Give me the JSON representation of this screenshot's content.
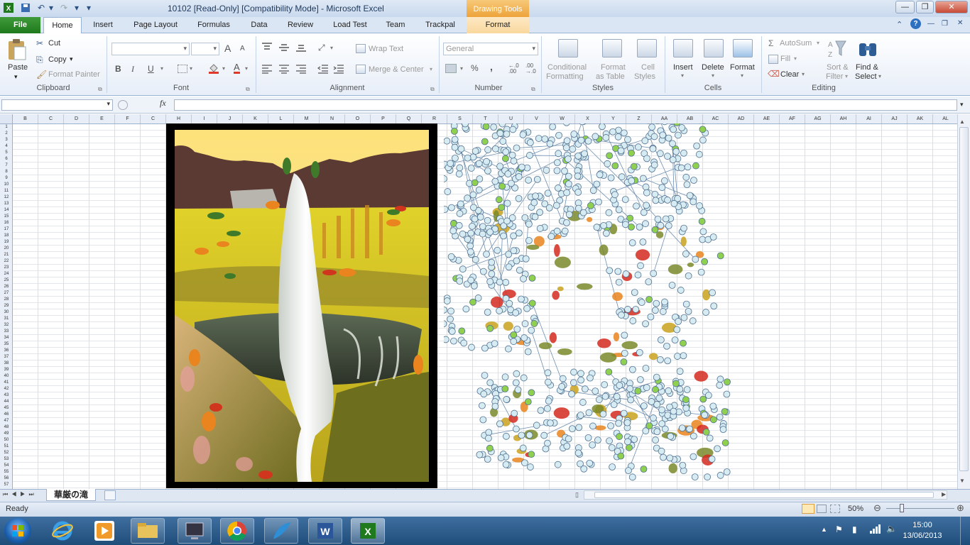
{
  "window": {
    "title": "10102  [Read-Only]  [Compatibility Mode]  -  Microsoft Excel",
    "contextual_group": "Drawing Tools",
    "buttons": {
      "minimize": "—",
      "restore": "❐",
      "close": "✕"
    }
  },
  "tabs": [
    {
      "label": "File"
    },
    {
      "label": "Home"
    },
    {
      "label": "Insert"
    },
    {
      "label": "Page Layout"
    },
    {
      "label": "Formulas"
    },
    {
      "label": "Data"
    },
    {
      "label": "Review"
    },
    {
      "label": "Load Test"
    },
    {
      "label": "Team"
    },
    {
      "label": "Trackpal"
    },
    {
      "label": "Format"
    }
  ],
  "ribbon": {
    "clipboard": {
      "paste": "Paste",
      "cut": "Cut",
      "copy": "Copy",
      "format_painter": "Format Painter",
      "label": "Clipboard"
    },
    "font": {
      "bold": "B",
      "italic": "I",
      "underline": "U",
      "grow": "A",
      "shrink": "A",
      "label": "Font"
    },
    "alignment": {
      "wrap_text": "Wrap Text",
      "merge_center": "Merge & Center",
      "label": "Alignment"
    },
    "number": {
      "format": "General",
      "percent": "%",
      "comma": ",",
      "label": "Number"
    },
    "styles": {
      "conditional": "Conditional",
      "conditional2": "Formatting",
      "format_table": "Format",
      "format_table2": "as Table",
      "cell_styles": "Cell",
      "cell_styles2": "Styles",
      "label": "Styles"
    },
    "cells": {
      "insert": "Insert",
      "delete": "Delete",
      "format": "Format",
      "label": "Cells"
    },
    "editing": {
      "autosum": "AutoSum",
      "fill": "Fill",
      "clear": "Clear",
      "sort": "Sort &",
      "sort2": "Filter",
      "find": "Find &",
      "find2": "Select",
      "label": "Editing"
    }
  },
  "formula_bar": {
    "fx": "fx",
    "name_box": "",
    "formula": ""
  },
  "columns": [
    "B",
    "C",
    "D",
    "E",
    "F",
    "C",
    "H",
    "I",
    "J",
    "K",
    "L",
    "M",
    "N",
    "O",
    "P",
    "Q",
    "R",
    "S",
    "T",
    "U",
    "V",
    "W",
    "X",
    "Y",
    "Z",
    "AA",
    "AB",
    "AC",
    "AD",
    "AE",
    "AF",
    "AG",
    "AH",
    "AI",
    "AJ",
    "AK",
    "AL"
  ],
  "sheet": {
    "tab_name": "華厳の滝"
  },
  "status": {
    "ready": "Ready",
    "zoom": "50%"
  },
  "clock": {
    "time": "15:00",
    "date": "13/06/2013"
  },
  "colors": {
    "accent": "#1e7a1c",
    "frame": "#000000",
    "leaf_red": "#d42a1f",
    "node_fill": "#d6ecf2",
    "node_green": "#8fd14f"
  }
}
